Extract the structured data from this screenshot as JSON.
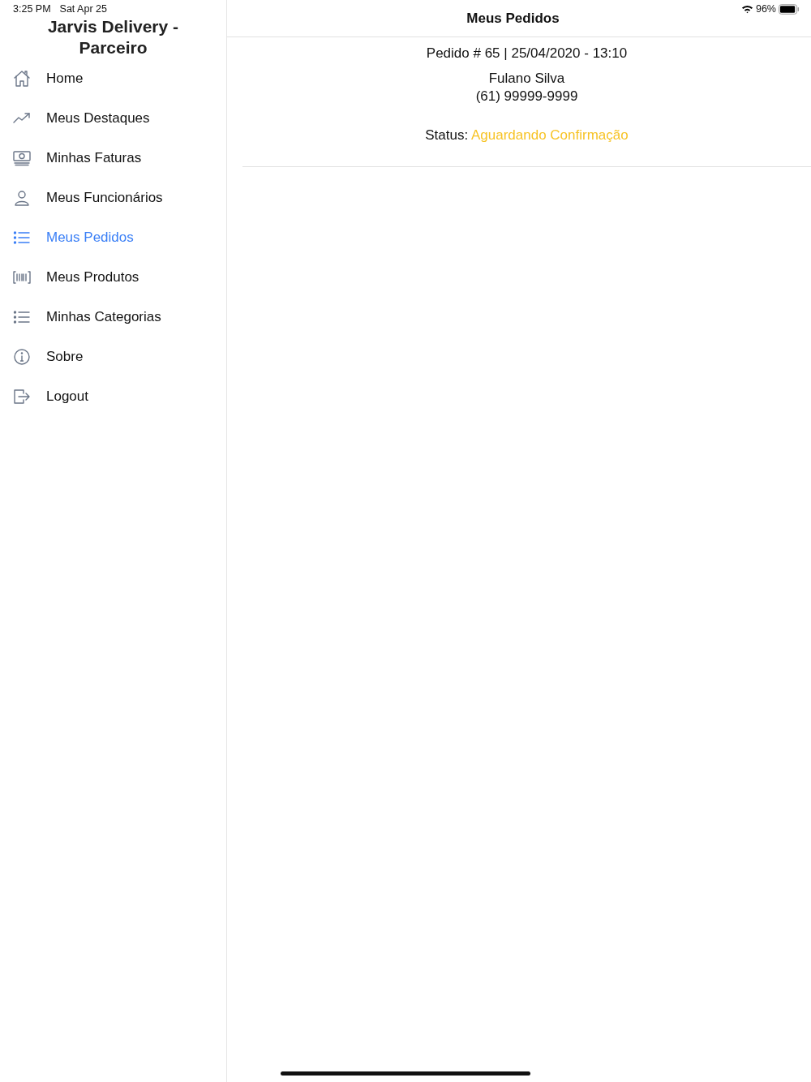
{
  "status_bar": {
    "time": "3:25 PM",
    "date": "Sat Apr 25",
    "battery": "96%"
  },
  "sidebar": {
    "title": "Jarvis Delivery - Parceiro",
    "items": [
      {
        "label": "Home",
        "kind": "home",
        "selected": false
      },
      {
        "label": "Meus Destaques",
        "kind": "trend",
        "selected": false
      },
      {
        "label": "Minhas Faturas",
        "kind": "money",
        "selected": false
      },
      {
        "label": "Meus Funcionários",
        "kind": "person",
        "selected": false
      },
      {
        "label": "Meus Pedidos",
        "kind": "list",
        "selected": true
      },
      {
        "label": "Meus Produtos",
        "kind": "barcode",
        "selected": false
      },
      {
        "label": "Minhas Categorias",
        "kind": "list",
        "selected": false
      },
      {
        "label": "Sobre",
        "kind": "info",
        "selected": false
      },
      {
        "label": "Logout",
        "kind": "logout",
        "selected": false
      }
    ]
  },
  "header": {
    "title": "Meus Pedidos"
  },
  "orders": [
    {
      "title": "Pedido # 65 | 25/04/2020 - 13:10",
      "customer": "Fulano Silva",
      "phone": "(61) 99999-9999",
      "status_label": "Status:",
      "status": "Aguardando Confirmação",
      "color": "#f7c325"
    }
  ]
}
